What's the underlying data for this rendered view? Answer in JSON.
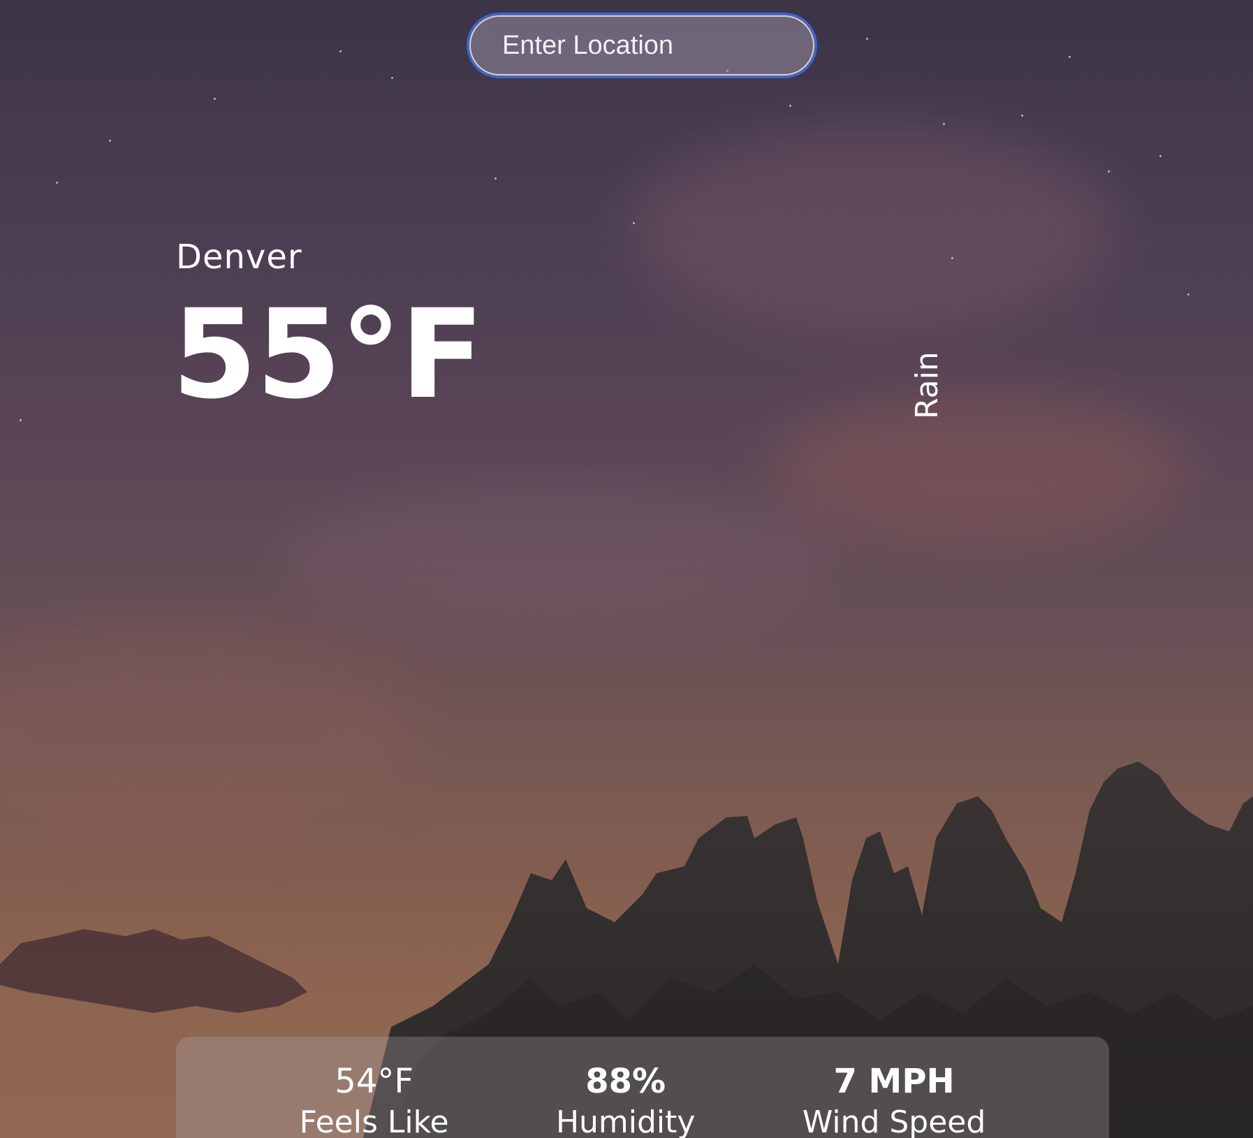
{
  "search": {
    "placeholder": "Enter Location"
  },
  "location": {
    "city": "Denver"
  },
  "current": {
    "temperature": "55°F",
    "condition": "Rain"
  },
  "details": [
    {
      "value": "54°F",
      "label": "Feels Like"
    },
    {
      "value": "88%",
      "label": "Humidity"
    },
    {
      "value": "7 MPH",
      "label": "Wind Speed"
    }
  ],
  "colors": {
    "input_border": "#3a63d9",
    "text": "#ffffff"
  }
}
